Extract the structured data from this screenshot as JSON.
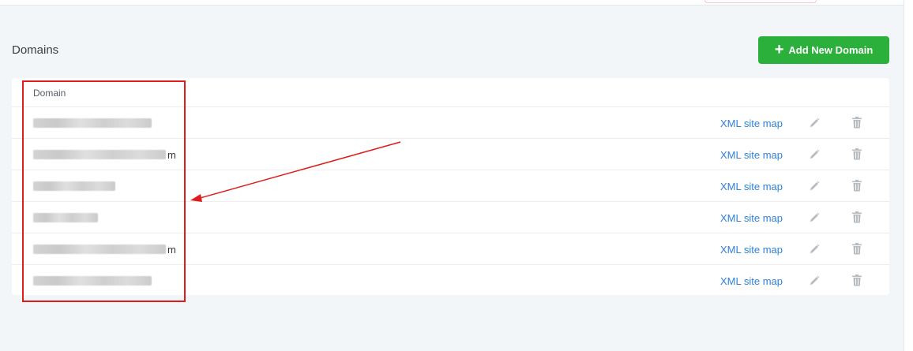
{
  "page": {
    "title": "Domains"
  },
  "actions": {
    "add_domain_label": "Add New Domain",
    "add_icon": "plus-icon"
  },
  "table": {
    "column_domain": "Domain",
    "rows": [
      {
        "domain_visible": "",
        "blur_widths": [
          150
        ],
        "suffix": "",
        "link_label": "XML site map"
      },
      {
        "domain_visible": "",
        "blur_widths": [
          168
        ],
        "suffix": "m",
        "link_label": "XML site map"
      },
      {
        "domain_visible": "",
        "blur_widths": [
          104
        ],
        "suffix": "",
        "link_label": "XML site map"
      },
      {
        "domain_visible": "",
        "blur_widths": [
          82
        ],
        "suffix": "",
        "link_label": "XML site map"
      },
      {
        "domain_visible": "",
        "blur_widths": [
          168
        ],
        "suffix": "m",
        "link_label": "XML site map"
      },
      {
        "domain_visible": "",
        "blur_widths": [
          150
        ],
        "suffix": "",
        "link_label": "XML site map"
      }
    ],
    "row_icons": [
      "pencil-icon",
      "trash-icon"
    ]
  },
  "colors": {
    "accent_green": "#2bb03b",
    "link_blue": "#2f82d6",
    "annotation_red": "#e01b1b",
    "background": "#f2f6f8"
  }
}
